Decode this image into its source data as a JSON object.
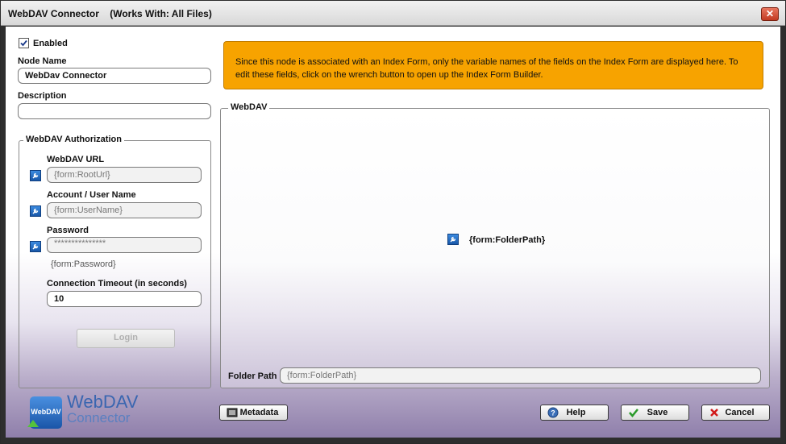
{
  "window": {
    "title": "WebDAV Connector",
    "works_with": "(Works With: All Files)",
    "close": "✕"
  },
  "left": {
    "enabled_label": "Enabled",
    "enabled_checked": true,
    "node_name_label": "Node Name",
    "node_name_value": "WebDav Connector",
    "description_label": "Description",
    "description_value": ""
  },
  "auth": {
    "legend": "WebDAV Authorization",
    "url_label": "WebDAV URL",
    "url_value": "{form:RootUrl}",
    "user_label": "Account / User Name",
    "user_value": "{form:UserName}",
    "password_label": "Password",
    "password_value": "***************",
    "password_var": "{form:Password}",
    "timeout_label": "Connection Timeout (in seconds)",
    "timeout_value": "10",
    "login_label": "Login"
  },
  "notice": {
    "text": "Since this node is associated with an Index Form, only the variable names of the fields on the Index Form are displayed here. To edit these fields, click on the wrench button to open up the Index Form Builder.",
    "color": "#f7a300"
  },
  "webdav": {
    "legend": "WebDAV",
    "folder_var": "{form:FolderPath}",
    "folder_path_label": "Folder Path",
    "folder_path_value": "{form:FolderPath}"
  },
  "logo": {
    "badge": "WebDAV",
    "line1": "WebDAV",
    "line2": "Connector"
  },
  "buttons": {
    "metadata": "Metadata",
    "help": "Help",
    "save": "Save",
    "cancel": "Cancel"
  }
}
